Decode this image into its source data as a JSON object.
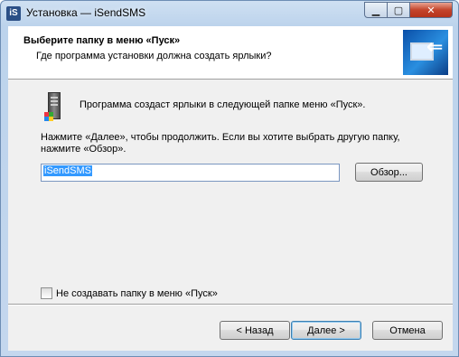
{
  "window": {
    "title": "Установка — iSendSMS",
    "icon_text": "iS",
    "caption_buttons": {
      "minimize": "▁",
      "maximize": "▢",
      "close": "✕"
    }
  },
  "header": {
    "title": "Выберите папку в меню «Пуск»",
    "subtitle": "Где программа установки должна создать ярлыки?"
  },
  "body": {
    "info_text": "Программа создаст ярлыки в следующей папке меню «Пуск».",
    "instruction_text": "Нажмите «Далее», чтобы продолжить. Если вы хотите выбрать другую папку, нажмите «Обзор».",
    "folder_value": "iSendSMS",
    "browse_label": "Обзор...",
    "no_folder_checkbox_label": "Не создавать папку в меню «Пуск»",
    "no_folder_checked": false
  },
  "footer": {
    "back_label": "< Назад",
    "next_label": "Далее >",
    "cancel_label": "Отмена"
  },
  "icons": {
    "app": "installer-icon",
    "wizard": "monitor-arrow-icon",
    "folder": "program-group-icon"
  }
}
